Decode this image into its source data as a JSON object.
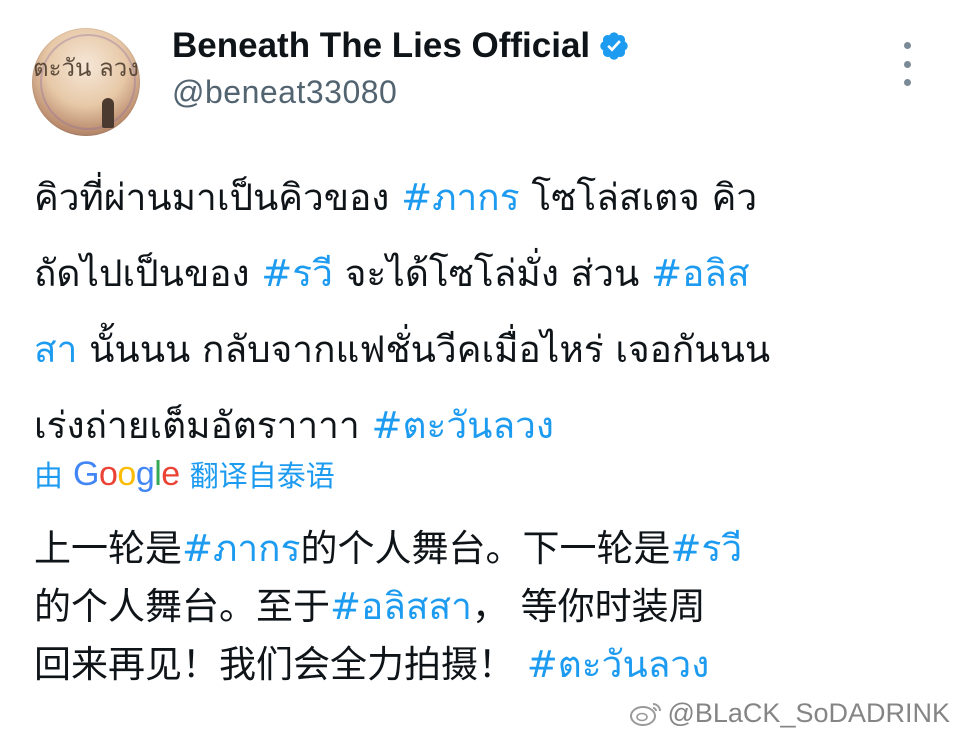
{
  "profile": {
    "avatar_logo_text": "ตะวัน ลวง",
    "display_name": "Beneath The Lies Official",
    "handle": "@beneat33080",
    "verified_icon": "verified-badge-icon",
    "more_icon": "more-vertical-icon"
  },
  "tweet": {
    "lines": [
      [
        {
          "t": "คิวที่ผ่านมาเป็นคิวของ "
        },
        {
          "t": "#ภากร",
          "tag": true
        },
        {
          "t": " โซโล่สเตจ คิว"
        }
      ],
      [
        {
          "t": "ถัดไปเป็นของ "
        },
        {
          "t": "#รวี",
          "tag": true
        },
        {
          "t": " จะได้โซโล่มั่ง ส่วน "
        },
        {
          "t": "#อลิส",
          "tag": true
        }
      ],
      [
        {
          "t": "สา",
          "tag": true
        },
        {
          "t": " นั้นนน กลับจากแฟชั่นวีคเมื่อไหร่ เจอกันนน"
        }
      ],
      [
        {
          "t": "เร่งถ่ายเต็มอัตราาาา "
        },
        {
          "t": "#ตะวันลวง",
          "tag": true
        }
      ]
    ]
  },
  "translation": {
    "prefix": "由",
    "provider": "Google",
    "suffix": "翻译自泰语",
    "lines": [
      [
        {
          "t": "上一轮是"
        },
        {
          "t": "#ภากร",
          "tag": true
        },
        {
          "t": "的个人舞台。下一轮是"
        },
        {
          "t": "#รวี",
          "tag": true
        }
      ],
      [
        {
          "t": "的个人舞台。至于"
        },
        {
          "t": "#อลิสสา",
          "tag": true
        },
        {
          "t": "，  等你时装周"
        }
      ],
      [
        {
          "t": "回来再见！我们会全力拍摄！  "
        },
        {
          "t": "#ตะวันลวง",
          "tag": true
        }
      ]
    ]
  },
  "watermark": {
    "text": "@BLaCK_SoDADRINK",
    "icon": "weibo-icon"
  },
  "colors": {
    "link": "#1d9bf0",
    "text": "#0f1419",
    "secondary": "#536471"
  }
}
